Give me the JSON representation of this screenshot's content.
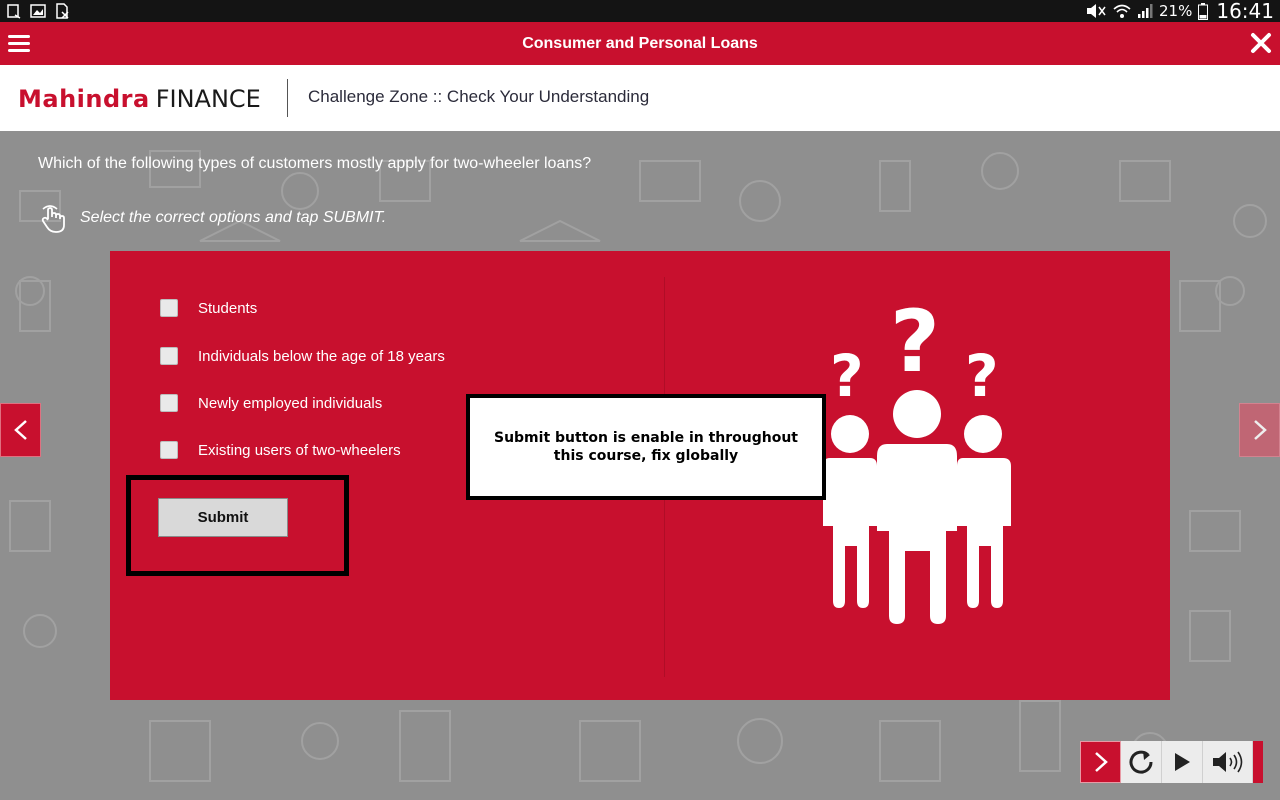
{
  "status_bar": {
    "left_icons": [
      "document-icon",
      "image-icon",
      "sim-card-icon"
    ],
    "battery": "21%",
    "time": "16:41"
  },
  "title_bar": {
    "title": "Consumer and Personal Loans"
  },
  "header": {
    "logo_brand": "Mahindra",
    "logo_suffix": "FINANCE",
    "section_title": "Challenge Zone :: Check Your Understanding"
  },
  "quiz": {
    "question": "Which of the following types of customers mostly apply for two-wheeler loans?",
    "instruction": "Select the correct options and tap SUBMIT.",
    "options": [
      {
        "label": "Students",
        "checked": false
      },
      {
        "label": "Individuals below the age of 18 years",
        "checked": false
      },
      {
        "label": "Newly employed individuals",
        "checked": false
      },
      {
        "label": "Existing users of two-wheelers",
        "checked": false
      }
    ],
    "submit_label": "Submit"
  },
  "annotation": {
    "text": "Submit button is enable in throughout this course, fix globally"
  },
  "colors": {
    "brand_red": "#c8102e",
    "background_gray": "#8f8f8f"
  },
  "controls": {
    "items": [
      "next-icon",
      "replay-icon",
      "play-icon",
      "volume-icon"
    ]
  }
}
